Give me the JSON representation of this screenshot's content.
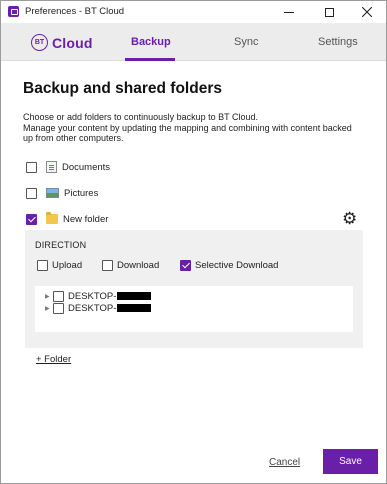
{
  "window": {
    "title": "Preferences - BT Cloud"
  },
  "header": {
    "logo_badge": "BT",
    "logo_text": "Cloud",
    "tabs": [
      {
        "label": "Backup",
        "active": true
      },
      {
        "label": "Sync",
        "active": false
      },
      {
        "label": "Settings",
        "active": false
      }
    ]
  },
  "main": {
    "title": "Backup and shared folders",
    "description_lines": [
      "Choose or add folders to continuously backup to BT Cloud.",
      "Manage your content by updating the mapping and combining with content backed",
      "up from other computers."
    ],
    "folders": [
      {
        "label": "Documents",
        "checked": false,
        "icon": "document-icon"
      },
      {
        "label": "Pictures",
        "checked": false,
        "icon": "picture-icon"
      },
      {
        "label": "New folder",
        "checked": true,
        "icon": "folder-icon"
      }
    ],
    "settings_icon": "gear-icon"
  },
  "direction": {
    "label": "DIRECTION",
    "options": [
      {
        "label": "Upload",
        "checked": false
      },
      {
        "label": "Download",
        "checked": false
      },
      {
        "label": "Selective Download",
        "checked": true
      }
    ],
    "devices": [
      {
        "label": "DESKTOP-",
        "checked": false
      },
      {
        "label": "DESKTOP-",
        "checked": false
      }
    ]
  },
  "actions": {
    "add_folder": "+ Folder",
    "cancel": "Cancel",
    "save": "Save"
  },
  "colors": {
    "accent": "#6a1fa8",
    "header_bg": "#ececec",
    "panel_bg": "#f0f0f0"
  }
}
